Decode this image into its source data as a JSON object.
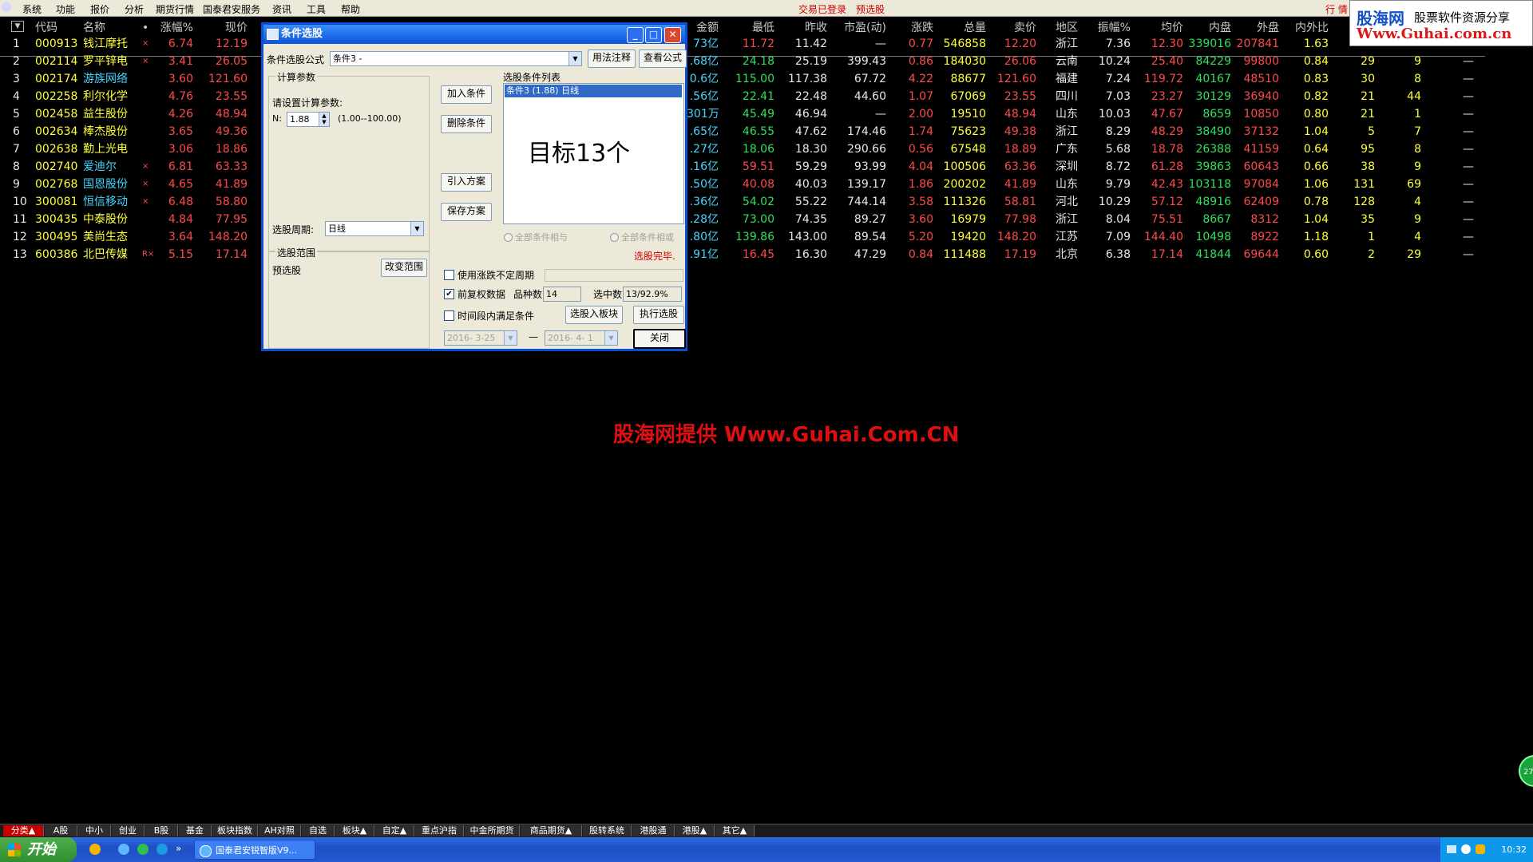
{
  "menu": {
    "items": [
      "系统",
      "功能",
      "报价",
      "分析",
      "期货行情",
      "国泰君安服务",
      "资讯",
      "工具",
      "帮助"
    ],
    "status_login": "交易已登录",
    "status_warn": "预选股",
    "quote_tab": "行 情"
  },
  "logo": {
    "line1a": "股海网",
    "line1b": "股票软件资源分享",
    "line2": "Www.Guhai.com.cn"
  },
  "table": {
    "headers": [
      "代码",
      "名称",
      "•",
      "涨幅%",
      "现价",
      "金额",
      "最低",
      "昨收",
      "市盈(动)",
      "涨跌",
      "总量",
      "卖价",
      "地区",
      "振幅%",
      "均价",
      "内盘",
      "外盘",
      "内外比"
    ],
    "rows": [
      {
        "no": "1",
        "code": "000913",
        "name": "钱江摩托",
        "mark": "×",
        "chg": "6.74",
        "price": "12.19",
        "amount": "73亿",
        "low": "11.72",
        "prev": "11.42",
        "pe": "—",
        "diff": "0.77",
        "vol": "546858",
        "ask": "12.20",
        "region": "浙江",
        "amp": "7.36",
        "avg": "12.30",
        "inner": "339016",
        "outer": "207841",
        "ratio": "1.63",
        "x1": "",
        "x2": "",
        "x3": ""
      },
      {
        "no": "2",
        "code": "002114",
        "name": "罗平锌电",
        "mark": "×",
        "chg": "3.41",
        "price": "26.05",
        "amount": ".68亿",
        "low": "24.18",
        "prev": "25.19",
        "pe": "399.43",
        "diff": "0.86",
        "vol": "184030",
        "ask": "26.06",
        "region": "云南",
        "amp": "10.24",
        "avg": "25.40",
        "inner": "84229",
        "outer": "99800",
        "ratio": "0.84",
        "x1": "29",
        "x2": "9",
        "x3": "—"
      },
      {
        "no": "3",
        "code": "002174",
        "name": "游族网络",
        "mark": "",
        "chg": "3.60",
        "price": "121.60",
        "amount": "0.6亿",
        "low": "115.00",
        "prev": "117.38",
        "pe": "67.72",
        "diff": "4.22",
        "vol": "88677",
        "ask": "121.60",
        "region": "福建",
        "amp": "7.24",
        "avg": "119.72",
        "inner": "40167",
        "outer": "48510",
        "ratio": "0.83",
        "x1": "30",
        "x2": "8",
        "x3": "—"
      },
      {
        "no": "4",
        "code": "002258",
        "name": "利尔化学",
        "mark": "",
        "chg": "4.76",
        "price": "23.55",
        "amount": ".56亿",
        "low": "22.41",
        "prev": "22.48",
        "pe": "44.60",
        "diff": "1.07",
        "vol": "67069",
        "ask": "23.55",
        "region": "四川",
        "amp": "7.03",
        "avg": "23.27",
        "inner": "30129",
        "outer": "36940",
        "ratio": "0.82",
        "x1": "21",
        "x2": "44",
        "x3": "—"
      },
      {
        "no": "5",
        "code": "002458",
        "name": "益生股份",
        "mark": "",
        "chg": "4.26",
        "price": "48.94",
        "amount": "301万",
        "low": "45.49",
        "prev": "46.94",
        "pe": "—",
        "diff": "2.00",
        "vol": "19510",
        "ask": "48.94",
        "region": "山东",
        "amp": "10.03",
        "avg": "47.67",
        "inner": "8659",
        "outer": "10850",
        "ratio": "0.80",
        "x1": "21",
        "x2": "1",
        "x3": "—"
      },
      {
        "no": "6",
        "code": "002634",
        "name": "棒杰股份",
        "mark": "",
        "chg": "3.65",
        "price": "49.36",
        "amount": ".65亿",
        "low": "46.55",
        "prev": "47.62",
        "pe": "174.46",
        "diff": "1.74",
        "vol": "75623",
        "ask": "49.38",
        "region": "浙江",
        "amp": "8.29",
        "avg": "48.29",
        "inner": "38490",
        "outer": "37132",
        "ratio": "1.04",
        "x1": "5",
        "x2": "7",
        "x3": "—"
      },
      {
        "no": "7",
        "code": "002638",
        "name": "勤上光电",
        "mark": "",
        "chg": "3.06",
        "price": "18.86",
        "amount": ".27亿",
        "low": "18.06",
        "prev": "18.30",
        "pe": "290.66",
        "diff": "0.56",
        "vol": "67548",
        "ask": "18.89",
        "region": "广东",
        "amp": "5.68",
        "avg": "18.78",
        "inner": "26388",
        "outer": "41159",
        "ratio": "0.64",
        "x1": "95",
        "x2": "8",
        "x3": "—"
      },
      {
        "no": "8",
        "code": "002740",
        "name": "爱迪尔",
        "mark": "×",
        "chg": "6.81",
        "price": "63.33",
        "amount": ".16亿",
        "low": "59.51",
        "prev": "59.29",
        "pe": "93.99",
        "diff": "4.04",
        "vol": "100506",
        "ask": "63.36",
        "region": "深圳",
        "amp": "8.72",
        "avg": "61.28",
        "inner": "39863",
        "outer": "60643",
        "ratio": "0.66",
        "x1": "38",
        "x2": "9",
        "x3": "—"
      },
      {
        "no": "9",
        "code": "002768",
        "name": "国恩股份",
        "mark": "×",
        "chg": "4.65",
        "price": "41.89",
        "amount": ".50亿",
        "low": "40.08",
        "prev": "40.03",
        "pe": "139.17",
        "diff": "1.86",
        "vol": "200202",
        "ask": "41.89",
        "region": "山东",
        "amp": "9.79",
        "avg": "42.43",
        "inner": "103118",
        "outer": "97084",
        "ratio": "1.06",
        "x1": "131",
        "x2": "69",
        "x3": "—"
      },
      {
        "no": "10",
        "code": "300081",
        "name": "恒信移动",
        "mark": "×",
        "chg": "6.48",
        "price": "58.80",
        "amount": ".36亿",
        "low": "54.02",
        "prev": "55.22",
        "pe": "744.14",
        "diff": "3.58",
        "vol": "111326",
        "ask": "58.81",
        "region": "河北",
        "amp": "10.29",
        "avg": "57.12",
        "inner": "48916",
        "outer": "62409",
        "ratio": "0.78",
        "x1": "128",
        "x2": "4",
        "x3": "—"
      },
      {
        "no": "11",
        "code": "300435",
        "name": "中泰股份",
        "mark": "",
        "chg": "4.84",
        "price": "77.95",
        "amount": ".28亿",
        "low": "73.00",
        "prev": "74.35",
        "pe": "89.27",
        "diff": "3.60",
        "vol": "16979",
        "ask": "77.98",
        "region": "浙江",
        "amp": "8.04",
        "avg": "75.51",
        "inner": "8667",
        "outer": "8312",
        "ratio": "1.04",
        "x1": "35",
        "x2": "9",
        "x3": "—"
      },
      {
        "no": "12",
        "code": "300495",
        "name": "美尚生态",
        "mark": "",
        "chg": "3.64",
        "price": "148.20",
        "amount": ".80亿",
        "low": "139.86",
        "prev": "143.00",
        "pe": "89.54",
        "diff": "5.20",
        "vol": "19420",
        "ask": "148.20",
        "region": "江苏",
        "amp": "7.09",
        "avg": "144.40",
        "inner": "10498",
        "outer": "8922",
        "ratio": "1.18",
        "x1": "1",
        "x2": "4",
        "x3": "—"
      },
      {
        "no": "13",
        "code": "600386",
        "name": "北巴传媒",
        "mark": "R×",
        "chg": "5.15",
        "price": "17.14",
        "amount": ".91亿",
        "low": "16.45",
        "prev": "16.30",
        "pe": "47.29",
        "diff": "0.84",
        "vol": "111488",
        "ask": "17.19",
        "region": "北京",
        "amp": "6.38",
        "avg": "17.14",
        "inner": "41844",
        "outer": "69644",
        "ratio": "0.60",
        "x1": "2",
        "x2": "29",
        "x3": "—"
      }
    ]
  },
  "watermark": "股海网提供 Www.Guhai.Com.CN",
  "green_ball": "27",
  "dialog": {
    "title": "条件选股",
    "formula_label": "条件选股公式",
    "formula_value": "条件3        -",
    "usage_btn": "用法注释",
    "view_btn": "查看公式",
    "calc_group": "计算参数",
    "calc_prompt": "请设置计算参数:",
    "n_label": "N:",
    "n_value": "1.88",
    "n_range": "(1.00--100.00)",
    "add_btn": "加入条件",
    "del_btn": "删除条件",
    "import_btn": "引入方案",
    "save_btn": "保存方案",
    "list_title": "选股条件列表",
    "list_item": "条件3 (1.88) 日线",
    "target_text": "目标13个",
    "period_label": "选股周期:",
    "period_value": "日线",
    "and_radio": "全部条件相与",
    "or_radio": "全部条件相或",
    "done_text": "选股完毕.",
    "range_group": "选股范围",
    "range_value": "预选股",
    "change_range_btn": "改变范围",
    "use_unfixed": "使用涨跌不定周期",
    "pre_adjust": "前复权数据",
    "count_label": "品种数",
    "count_value": "14",
    "selected_label": "选中数",
    "selected_value": "13/92.9%",
    "time_cond": "时间段内满足条件",
    "to_block_btn": "选股入板块",
    "run_btn": "执行选股",
    "date_from": "2016- 3-25",
    "date_sep": "—",
    "date_to": "2016- 4- 1",
    "close_btn": "关闭"
  },
  "bottom_tabs": [
    "分类▲",
    "A股",
    "中小",
    "创业",
    "B股",
    "基金",
    "板块指数",
    "AH对照",
    "自选",
    "板块▲",
    "自定▲",
    "重点沪指",
    "中金所期货",
    "商品期货▲",
    "股转系统",
    "港股通",
    "港股▲",
    "其它▲"
  ],
  "taskbar": {
    "start": "开始",
    "task_label": "国泰君安锐智版V9...",
    "time": "10:32"
  }
}
